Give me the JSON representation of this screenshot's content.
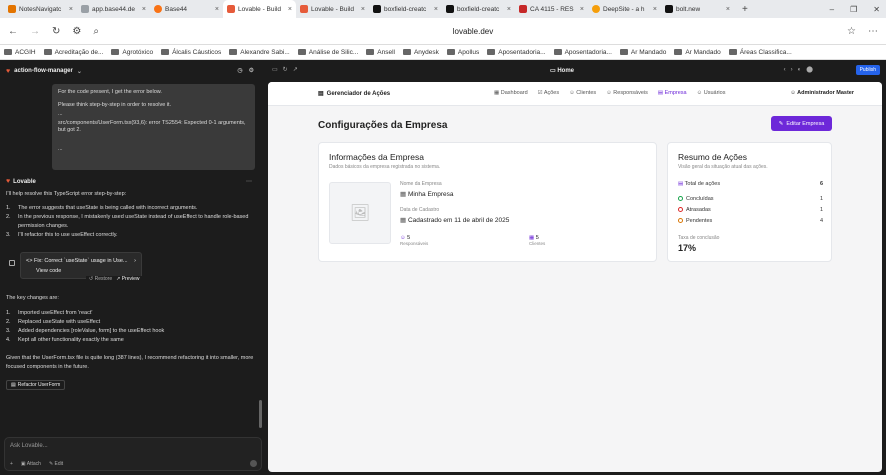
{
  "browser": {
    "tabs": [
      {
        "label": "NotesNavigatc",
        "color": "#e37400"
      },
      {
        "label": "app.base44.de",
        "color": "#9aa0a6"
      },
      {
        "label": "Base44",
        "color": "#f97316"
      },
      {
        "label": "Lovable - Build fo",
        "color": "#e65b3a"
      },
      {
        "label": "Lovable - Build",
        "color": "#e65b3a"
      },
      {
        "label": "boxfield-creatc",
        "color": "#111111"
      },
      {
        "label": "boxfield-creatc",
        "color": "#111111"
      },
      {
        "label": "CA 4115 - RES",
        "color": "#c62828"
      },
      {
        "label": "DeepSite - a h",
        "color": "#f59e0b"
      },
      {
        "label": "bolt.new",
        "color": "#111111"
      }
    ],
    "url": "lovable.dev",
    "bookmarks": [
      "ACGIH",
      "Acreditação de...",
      "Agrotóxico",
      "Álcalis Cáusticos",
      "Alexandre Sabi...",
      "Análise de Silic...",
      "Ansell",
      "Anydesk",
      "Apollus",
      "Aposentadoria...",
      "Aposentadoria...",
      "Ar Mandado",
      "Ar Mandado",
      "Áreas Classifica..."
    ]
  },
  "chat": {
    "project_name": "action-flow-manager",
    "user_message": {
      "line1": "For the code present, I get the error below.",
      "line2": "Please think step-by-step in order to resolve it.",
      "line3": "...",
      "line4": "src/components/UserForm.tsx(93,6): error TS2554: Expected 0-1 arguments, but got 2.",
      "line5": "..."
    },
    "assistant_name": "Lovable",
    "intro": "I'll help resolve this TypeScript error step-by-step:",
    "steps": [
      {
        "n": "1.",
        "text": "The error suggests that useState is being called with incorrect arguments."
      },
      {
        "n": "2.",
        "text": "In the previous response, I mistakenly used useState instead of useEffect to handle role-based permission changes."
      },
      {
        "n": "3.",
        "text": "I'll refactor this to use useEffect correctly."
      }
    ],
    "fix_card": {
      "title": "Fix: Correct `useState` usage in Use...",
      "view": "View code",
      "restore": "Restore",
      "preview": "Preview"
    },
    "key_changes_title": "The key changes are:",
    "changes": [
      {
        "n": "1.",
        "text": "Imported useEffect from 'react'"
      },
      {
        "n": "2.",
        "text": "Replaced useState with useEffect"
      },
      {
        "n": "3.",
        "text": "Added dependencies [roleValue, form] to the useEffect hook"
      },
      {
        "n": "4.",
        "text": "Kept all other functionality exactly the same"
      }
    ],
    "closing": "Given that the UserForm.tsx file is quite long (387 lines), I recommend refactoring it into smaller, more focused components in the future.",
    "refactor_button": "Refactor UserForm",
    "input_placeholder": "Ask Lovable...",
    "attach": "Attach",
    "edit": "Edit"
  },
  "preview_bar": {
    "route": "Home",
    "publish": "Publish"
  },
  "app": {
    "brand": "Gerenciador de Ações",
    "nav": [
      {
        "label": "Dashboard",
        "active": false
      },
      {
        "label": "Ações",
        "active": false
      },
      {
        "label": "Clientes",
        "active": false
      },
      {
        "label": "Responsáveis",
        "active": false
      },
      {
        "label": "Empresa",
        "active": true
      },
      {
        "label": "Usuários",
        "active": false
      }
    ],
    "user": "Administrador Master",
    "page_title": "Configurações da Empresa",
    "edit_button": "Editar Empresa",
    "company_card": {
      "title": "Informações da Empresa",
      "subtitle": "Dados básicos da empresa registrada no sistema.",
      "name_label": "Nome da Empresa",
      "name_value": "Minha Empresa",
      "date_label": "Data de Cadastro",
      "date_value": "Cadastrado em 11 de abril de 2025",
      "responsaveis_count": "5",
      "responsaveis_label": "Responsáveis",
      "clientes_count": "5",
      "clientes_label": "Clientes"
    },
    "summary_card": {
      "title": "Resumo de Ações",
      "subtitle": "Visão geral da situação atual das ações.",
      "rows": [
        {
          "label": "Total de ações",
          "value": "6",
          "color": "#6d28d9"
        },
        {
          "label": "Concluídas",
          "value": "1",
          "color": "#16a34a"
        },
        {
          "label": "Atrasadas",
          "value": "1",
          "color": "#dc2626"
        },
        {
          "label": "Pendentes",
          "value": "4",
          "color": "#d97706"
        }
      ],
      "rate_label": "Taxa de conclusão",
      "rate_value": "17%"
    },
    "accent": "#6d28d9"
  }
}
